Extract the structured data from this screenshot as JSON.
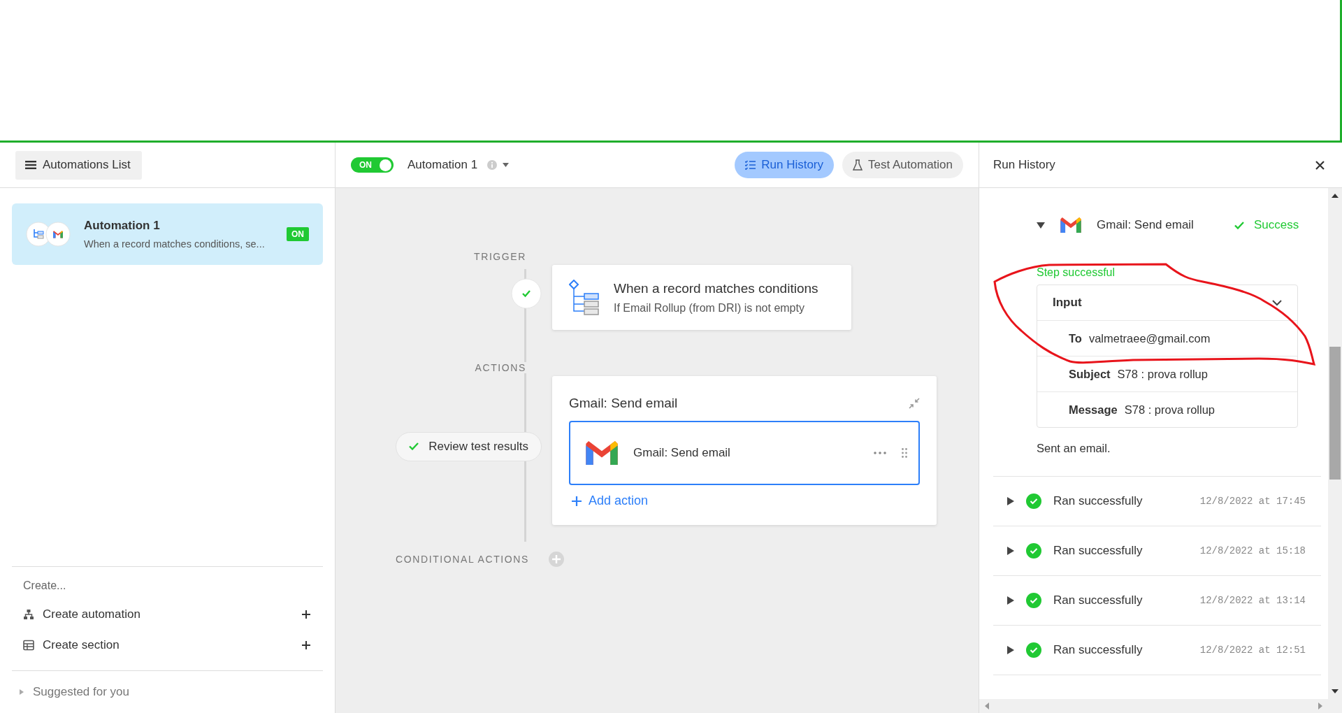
{
  "sidebar": {
    "header_button": "Automations List",
    "automations": [
      {
        "title": "Automation 1",
        "description": "When a record matches conditions, se...",
        "badge": "ON",
        "selected": true
      }
    ],
    "create": {
      "heading": "Create...",
      "items": [
        {
          "kind": "automation",
          "label": "Create automation"
        },
        {
          "kind": "section",
          "label": "Create section"
        }
      ]
    },
    "suggested": {
      "label": "Suggested for you",
      "expanded": false
    }
  },
  "toolbar": {
    "toggle": {
      "label": "ON",
      "on": true
    },
    "automation_name": "Automation 1",
    "tabs": [
      {
        "kind": "history",
        "label": "Run History",
        "selected": true
      },
      {
        "kind": "test",
        "label": "Test Automation",
        "selected": false
      }
    ]
  },
  "canvas": {
    "trigger_label": "TRIGGER",
    "trigger": {
      "title": "When a record matches conditions",
      "subtitle": "If Email Rollup (from DRI) is not empty"
    },
    "actions_label": "ACTIONS",
    "review_button": "Review test results",
    "action_group": {
      "title": "Gmail: Send email",
      "items": [
        {
          "label": "Gmail: Send email",
          "selected": true
        }
      ],
      "add_action": "Add action"
    },
    "conditional_label": "CONDITIONAL ACTIONS"
  },
  "run_history": {
    "title": "Run History",
    "open_run": {
      "step": "Gmail: Send email",
      "status": "Success",
      "expanded": true,
      "step_status": "Step successful",
      "input": {
        "title": "Input",
        "fields": [
          {
            "label": "To",
            "value": "valmetraee@gmail.com"
          },
          {
            "label": "Subject",
            "value": "S78 : prova rollup"
          },
          {
            "label": "Message",
            "value": "S78 : prova rollup"
          }
        ]
      },
      "result": "Sent an email."
    },
    "runs": [
      {
        "status": "Ran successfully",
        "time": "12/8/2022 at 17:45",
        "expanded": false
      },
      {
        "status": "Ran successfully",
        "time": "12/8/2022 at 15:18",
        "expanded": false
      },
      {
        "status": "Ran successfully",
        "time": "12/8/2022 at 13:14",
        "expanded": false
      },
      {
        "status": "Ran successfully",
        "time": "12/8/2022 at 12:51",
        "expanded": false
      }
    ]
  }
}
